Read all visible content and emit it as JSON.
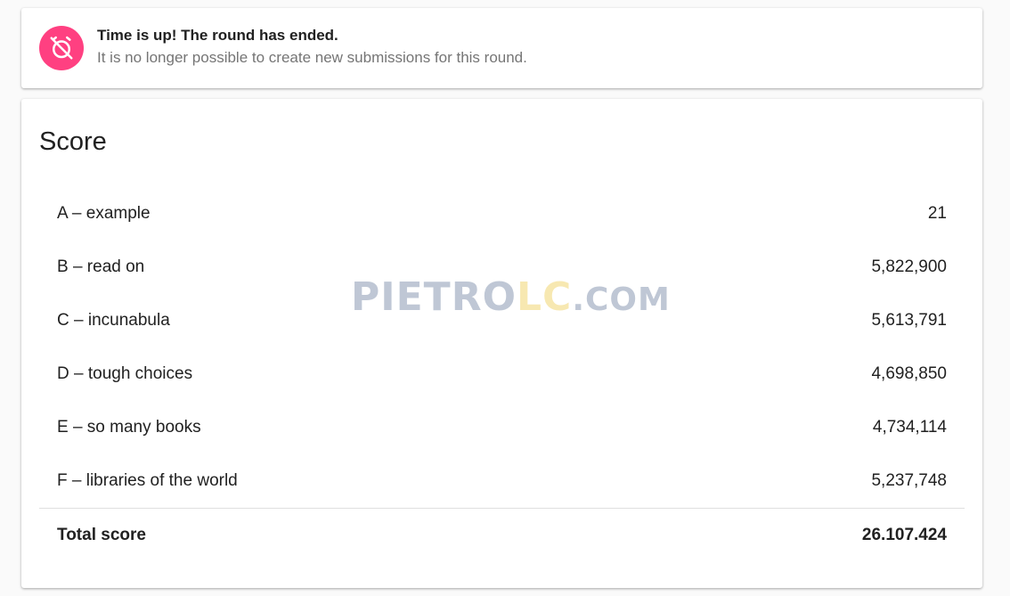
{
  "notice": {
    "icon": "alarm-off-icon",
    "icon_color": "#ff4081",
    "title": "Time is up! The round has ended.",
    "text": "It is no longer possible to create new submissions for this round."
  },
  "score": {
    "title": "Score",
    "rows": [
      {
        "label": "A – example",
        "value": "21"
      },
      {
        "label": "B – read on",
        "value": "5,822,900"
      },
      {
        "label": "C – incunabula",
        "value": "5,613,791"
      },
      {
        "label": "D – tough choices",
        "value": "4,698,850"
      },
      {
        "label": "E – so many books",
        "value": "4,734,114"
      },
      {
        "label": "F – libraries of the world",
        "value": "5,237,748"
      }
    ],
    "total_label": "Total score",
    "total_value": "26.107.424"
  },
  "watermark": {
    "part1": "PIETRO",
    "part2": "LC",
    "part3": ".COM"
  }
}
